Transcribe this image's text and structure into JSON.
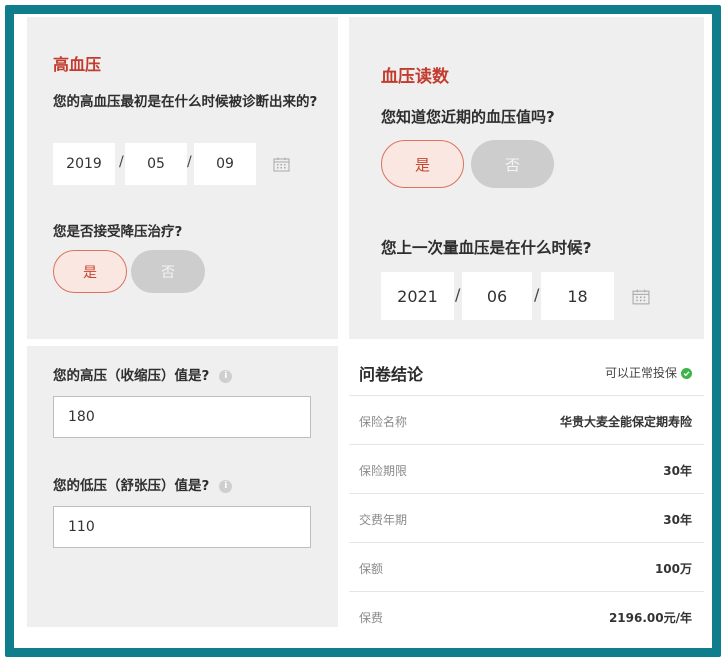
{
  "hypertension": {
    "title": "高血压",
    "question_diagnosed": "您的高血压最初是在什么时候被诊断出来的?",
    "diagnosed_date": {
      "year": "2019",
      "month": "05",
      "day": "09"
    },
    "question_treatment": "您是否接受降压治疗?",
    "yes_label": "是",
    "no_label": "否",
    "selected": "是"
  },
  "bp_reading": {
    "title": "血压读数",
    "question_known": "您知道您近期的血压值吗?",
    "yes_label": "是",
    "no_label": "否",
    "selected": "是",
    "question_last": "您上一次量血压是在什么时候?",
    "last_date": {
      "year": "2021",
      "month": "06",
      "day": "18"
    }
  },
  "values": {
    "systolic_label": "您的高压（收缩压）值是?",
    "systolic_value": "180",
    "diastolic_label": "您的低压（舒张压）值是?",
    "diastolic_value": "110"
  },
  "conclusion": {
    "title": "问卷结论",
    "status": "可以正常投保",
    "status_color": "#3cb44a",
    "rows": [
      {
        "key": "保险名称",
        "value": "华贵大麦全能保定期寿险"
      },
      {
        "key": "保险期限",
        "value": "30年"
      },
      {
        "key": "交费年期",
        "value": "30年"
      },
      {
        "key": "保额",
        "value": "100万"
      },
      {
        "key": "保费",
        "value": "2196.00元/年"
      }
    ]
  },
  "separator": "/",
  "icons": {
    "calendar": "calendar-icon",
    "info": "info-icon",
    "check": "check-circle-icon"
  },
  "colors": {
    "border": "#0f7d8c",
    "accent_red": "#c33b2d",
    "panel_bg": "#efefef"
  }
}
